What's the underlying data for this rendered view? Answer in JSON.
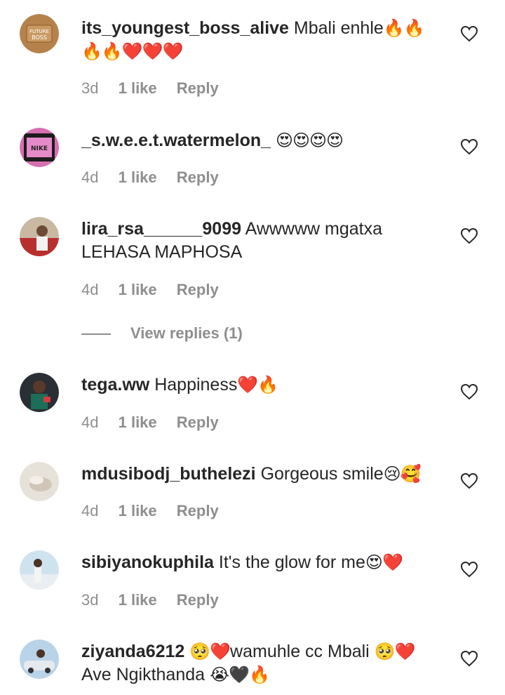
{
  "comments": [
    {
      "user": "its_youngest_boss_alive",
      "text": "Mbali enhle",
      "emoji1": "🔥🔥",
      "line2": "",
      "emoji2": "🔥🔥❤️❤️❤️",
      "age": "3d",
      "likes": "1 like",
      "reply": "Reply"
    },
    {
      "user": "_s.w.e.e.t.watermelon_",
      "text": "",
      "emoji1": "😍😍😍😍",
      "line2": "",
      "emoji2": "",
      "age": "4d",
      "likes": "1 like",
      "reply": "Reply"
    },
    {
      "user": "lira_rsa______9099",
      "text": "Awwwww mgatxa",
      "emoji1": "",
      "line2": "LEHASA MAPHOSA",
      "emoji2": "",
      "age": "4d",
      "likes": "1 like",
      "reply": "Reply"
    },
    {
      "user": "tega.ww",
      "text": "Happiness",
      "emoji1": "❤️🔥",
      "line2": "",
      "emoji2": "",
      "age": "4d",
      "likes": "1 like",
      "reply": "Reply"
    },
    {
      "user": "mdusibodj_buthelezi",
      "text": "Gorgeous smile",
      "emoji1": "😢🥰",
      "line2": "",
      "emoji2": "",
      "age": "4d",
      "likes": "1 like",
      "reply": "Reply"
    },
    {
      "user": "sibiyanokuphila",
      "text": "It's the glow for me",
      "emoji1": "😍❤️",
      "line2": "",
      "emoji2": "",
      "age": "3d",
      "likes": "1 like",
      "reply": "Reply"
    },
    {
      "user": "ziyanda6212",
      "text": "",
      "emoji1": "🥺❤️",
      "line2": "Ave Ngikthanda",
      "emoji2": "😭🖤🔥",
      "text_after": "wamuhle cc Mbali",
      "emoji_after": "🥺❤️",
      "age": "",
      "likes": "",
      "reply": ""
    }
  ],
  "view_replies": "View replies (1)",
  "icons": {
    "like": "heart-outline-icon"
  }
}
